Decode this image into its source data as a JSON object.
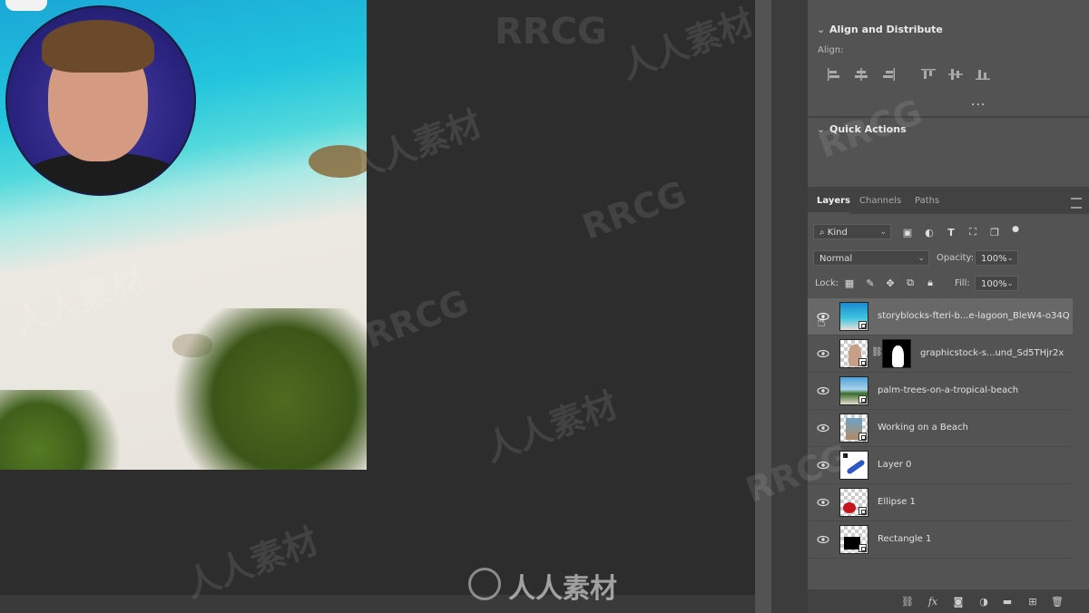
{
  "watermarks": {
    "brand_latin": "RRCG",
    "brand_cjk": "人人素材"
  },
  "align_panel": {
    "title": "Align and Distribute",
    "align_label": "Align:",
    "icons": [
      "align-left-edges-icon",
      "align-horizontal-centers-icon",
      "align-right-edges-icon",
      "align-top-edges-icon",
      "align-vertical-centers-icon",
      "align-bottom-edges-icon"
    ],
    "more_label": "..."
  },
  "quick_actions": {
    "title": "Quick Actions"
  },
  "layers_panel": {
    "tabs": [
      "Layers",
      "Channels",
      "Paths"
    ],
    "filter": {
      "kind_label": "Kind"
    },
    "blend_mode": "Normal",
    "opacity_label": "Opacity:",
    "opacity_value": "100%",
    "lock_label": "Lock:",
    "fill_label": "Fill:",
    "fill_value": "100%",
    "layers": [
      {
        "name": "storyblocks-fteri-b...e-lagoon_BleW4-o34Q",
        "selected": true
      },
      {
        "name": "graphicstock-s...und_Sd5THjr2x",
        "selected": false
      },
      {
        "name": "palm-trees-on-a-tropical-beach",
        "selected": false
      },
      {
        "name": "Working on a Beach",
        "selected": false
      },
      {
        "name": "Layer 0",
        "selected": false
      },
      {
        "name": "Ellipse 1",
        "selected": false
      },
      {
        "name": "Rectangle 1",
        "selected": false
      }
    ],
    "bottom_icons": [
      "link-layers-icon",
      "fx-icon",
      "add-mask-icon",
      "adjustment-layer-icon",
      "new-group-icon",
      "new-layer-icon",
      "delete-layer-icon"
    ]
  },
  "colors": {
    "panel_bg": "#535353",
    "canvas_bg": "#2d2d2d",
    "selected_row": "#686868"
  }
}
